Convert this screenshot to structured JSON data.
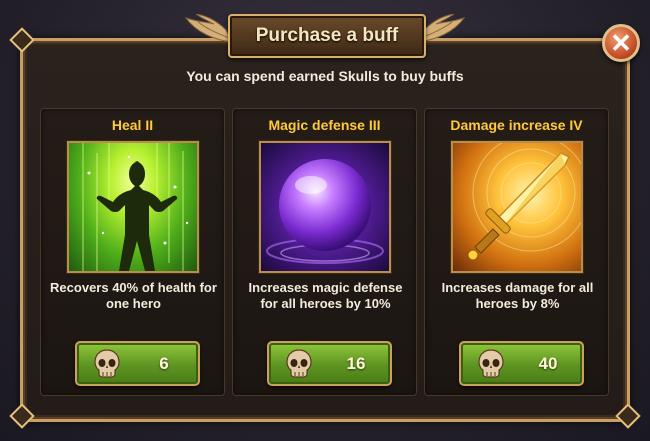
{
  "dialog": {
    "title": "Purchase a buff",
    "subtitle": "You can spend earned Skulls to buy buffs",
    "close_icon": "close-icon"
  },
  "buffs": [
    {
      "title": "Heal II",
      "description": "Recovers 40% of health for one hero",
      "price": "6",
      "art": "heal-hero-icon",
      "accent": "#7fd02a"
    },
    {
      "title": "Magic defense III",
      "description": "Increases magic defense for all heroes by 10%",
      "price": "16",
      "art": "magic-orb-icon",
      "accent": "#a050e8"
    },
    {
      "title": "Damage increase IV",
      "description": "Increases damage for all heroes by 8%",
      "price": "40",
      "art": "golden-sword-icon",
      "accent": "#f0b020"
    }
  ],
  "currency_icon": "skull-icon"
}
